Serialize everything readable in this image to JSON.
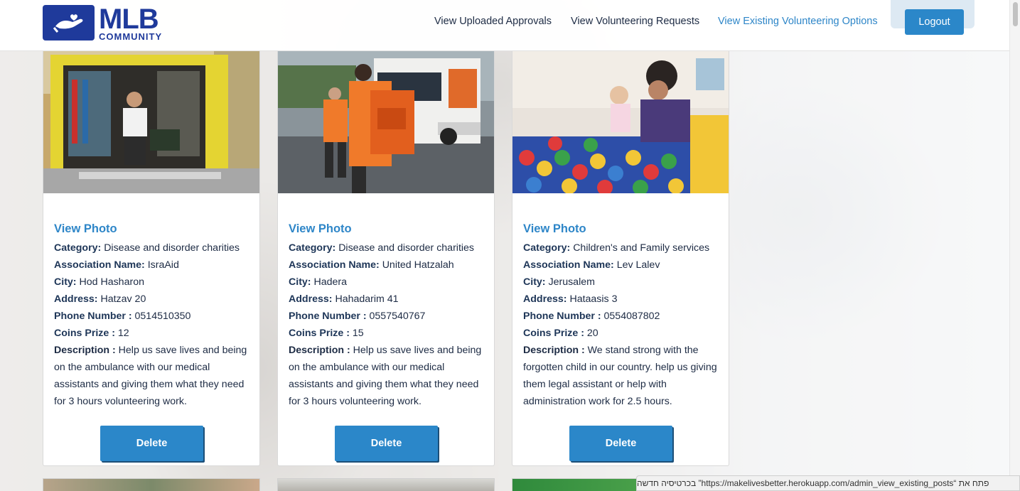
{
  "brand": {
    "main": "MLB",
    "sub": "COMMUNITY",
    "icon": "hand-heart-icon"
  },
  "nav": {
    "links": [
      {
        "label": "View Uploaded Approvals",
        "active": false
      },
      {
        "label": "View Volunteering Requests",
        "active": false
      },
      {
        "label": "View Existing Volunteering Options",
        "active": true
      }
    ],
    "logout_label": "Logout"
  },
  "labels": {
    "view_photo": "View Photo",
    "category": "Category:",
    "association": "Association Name:",
    "city": "City:",
    "address": "Address:",
    "phone": "Phone Number :",
    "coins": "Coins Prize :",
    "description": "Description :",
    "delete": "Delete"
  },
  "cards": [
    {
      "photo": "ambulance-medic-photo",
      "category": "Disease and disorder charities",
      "association": "IsraAid",
      "city": "Hod Hasharon",
      "address": "Hatzav 20",
      "phone": "0514510350",
      "coins": "12",
      "description": "Help us save lives and being on the ambulance with our medical assistants and giving them what they need for 3 hours volunteering work."
    },
    {
      "photo": "hatzalah-volunteers-photo",
      "category": "Disease and disorder charities",
      "association": "United Hatzalah",
      "city": "Hadera",
      "address": "Hahadarim 41",
      "phone": "0557540767",
      "coins": "15",
      "description": "Help us save lives and being on the ambulance with our medical assistants and giving them what they need for 3 hours volunteering work."
    },
    {
      "photo": "ball-pit-child-photo",
      "category": "Children's and Family services",
      "association": "Lev Lalev",
      "city": "Jerusalem",
      "address": "Hataasis 3",
      "phone": "0554087802",
      "coins": "20",
      "description": "We stand strong with the forgotten child in our country. help us giving them legal assistant or help with administration work for 2.5 hours."
    }
  ],
  "status_bar": {
    "prefix": "פתח את",
    "url": "https://makelivesbetter.herokuapp.com/admin_view_existing_posts",
    "suffix": "בכרטיסיה חדשה"
  },
  "colors": {
    "brand": "#1f3a9b",
    "accent": "#2b87c9",
    "link": "#2e86c8"
  }
}
